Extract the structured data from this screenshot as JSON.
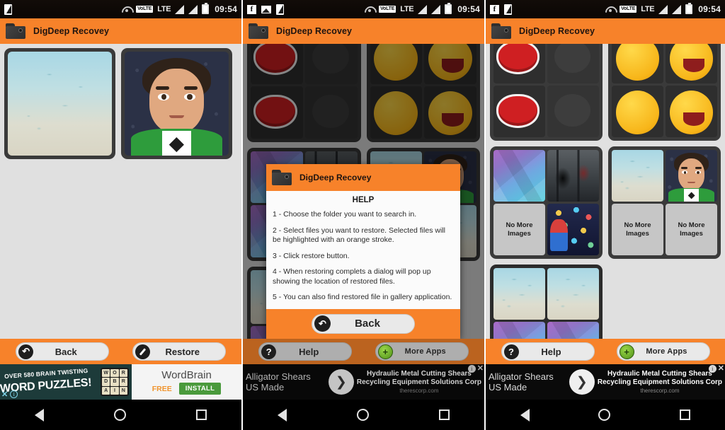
{
  "app": {
    "title": "DigDeep Recovey",
    "accent_color": "#f7822a",
    "folder_icon": "folder-icon"
  },
  "status_bar": {
    "clock": "09:54",
    "volte_label": "VoLTE",
    "lte_label": "LTE",
    "icons_panel1": [
      "sim-card-icon"
    ],
    "icons_panel2": [
      "facebook-icon",
      "screenshot-icon",
      "sim-card-icon"
    ],
    "icons_panel3": [
      "facebook-icon",
      "sim-card-icon"
    ],
    "right_icons": [
      "wifi-icon",
      "volte-icon",
      "lte-icon",
      "signal-icon",
      "signal-icon",
      "battery-icon"
    ]
  },
  "panel1": {
    "buttons": [
      {
        "label": "Back",
        "icon": "back-arrow-icon"
      },
      {
        "label": "Restore",
        "icon": "restore-icon"
      }
    ],
    "images": [
      "sky-photo",
      "avatar-photo"
    ]
  },
  "panel2": {
    "buttons": [
      {
        "label": "Help",
        "icon": "question-mark-icon"
      },
      {
        "label": "More Apps",
        "icon": "plus-circle-icon"
      }
    ]
  },
  "panel3": {
    "buttons": [
      {
        "label": "Help",
        "icon": "question-mark-icon"
      },
      {
        "label": "More Apps",
        "icon": "plus-circle-icon"
      }
    ],
    "placeholder_label": "No More Images"
  },
  "dialog": {
    "title": "DigDeep Recovey",
    "heading": "HELP",
    "steps": [
      "1 - Choose the folder you want to search in.",
      "2 - Select files you want to restore. Selected files will be highlighted with an orange stroke.",
      "3 - Click restore button.",
      "4 - When restoring complets a dialog will pop up showing the location of restored files.",
      "5 - You can also find restored file in gallery application."
    ],
    "back_label": "Back",
    "back_icon": "back-arrow-icon"
  },
  "ads": {
    "wordbrain": {
      "line1": "OVER 580 BRAIN TWISTING",
      "line2": "WORD PUZZLES!",
      "tiles": [
        "W",
        "O",
        "R",
        "D",
        "B",
        "R",
        "A",
        "I",
        "N"
      ],
      "title": "WordBrain",
      "price": "FREE",
      "cta": "INSTALL",
      "close_icon": "close-icon",
      "info_icon": "info-icon"
    },
    "alligator": {
      "left_line1": "Alligator Shears",
      "left_line2": "US Made",
      "chevron": "chevron-right-icon",
      "right_line1": "Hydraulic Metal Cutting Shears",
      "right_line2": "Recycling Equipment Solutions Corp",
      "url": "therescorp.com",
      "info_icon": "info-icon",
      "close_icon": "close-icon"
    }
  },
  "navbar": {
    "back": "back-triangle-icon",
    "home": "home-circle-icon",
    "recents": "recents-square-icon"
  }
}
